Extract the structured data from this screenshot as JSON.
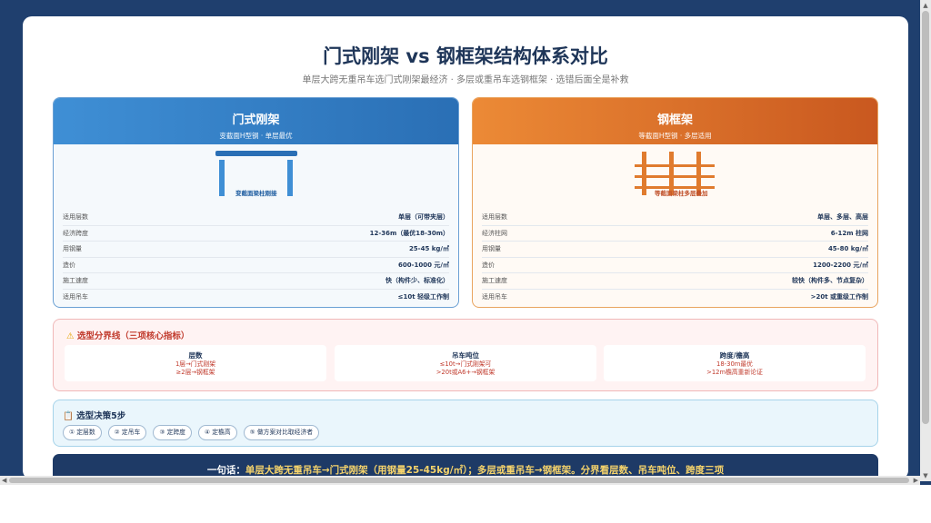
{
  "page": {
    "title": "门式刚架 vs 钢框架结构体系对比",
    "subtitle": "单层大跨无重吊车选门式刚架最经济 · 多层或重吊车选钢框架 · 选错后面全是补救"
  },
  "portal": {
    "name": "门式刚架",
    "sub": "变截面H型钢 · 单层最优",
    "diagram_label": "变截面梁柱刚接",
    "rows": [
      {
        "k": "适用层数",
        "v": "单层（可带夹层）"
      },
      {
        "k": "经济跨度",
        "v": "12-36m（最优18-30m）"
      },
      {
        "k": "用钢量",
        "v": "25-45 kg/㎡"
      },
      {
        "k": "造价",
        "v": "600-1000 元/㎡"
      },
      {
        "k": "施工速度",
        "v": "快（构件少、标准化）"
      },
      {
        "k": "适用吊车",
        "v": "≤10t 轻级工作制"
      }
    ],
    "color": "#3a86cc"
  },
  "frame": {
    "name": "钢框架",
    "sub": "等截面H型钢 · 多层适用",
    "diagram_label": "等截面梁柱多层叠加",
    "rows": [
      {
        "k": "适用层数",
        "v": "单层、多层、高层"
      },
      {
        "k": "经济柱网",
        "v": "6-12m 柱网"
      },
      {
        "k": "用钢量",
        "v": "45-80 kg/㎡"
      },
      {
        "k": "造价",
        "v": "1200-2200 元/㎡"
      },
      {
        "k": "施工速度",
        "v": "较快（构件多、节点复杂）"
      },
      {
        "k": "适用吊车",
        "v": ">20t 或重级工作制"
      }
    ],
    "color": "#e07b2e"
  },
  "boundary": {
    "icon": "warning-icon",
    "title": "选型分界线（三项核心指标）",
    "items": [
      {
        "head": "层数",
        "l1": "1层→门式刚架",
        "l2": "≥2层→钢框架"
      },
      {
        "head": "吊车吨位",
        "l1": "≤10t→门式刚架可",
        "l2": ">20t或A6+→钢框架"
      },
      {
        "head": "跨度/檐高",
        "l1": "18-30m最优",
        "l2": ">12m檐高重新论证"
      }
    ]
  },
  "steps": {
    "icon": "clipboard-icon",
    "title": "选型决策5步",
    "items": [
      "① 定层数",
      "② 定吊车",
      "③ 定跨度",
      "④ 定檐高",
      "⑤ 做方案对比取经济者"
    ]
  },
  "footer": {
    "lead": "一句话：",
    "text": "单层大跨无重吊车→门式刚架（用钢量25-45kg/㎡）；多层或重吊车→钢框架。分界看层数、吊车吨位、跨度三项"
  }
}
